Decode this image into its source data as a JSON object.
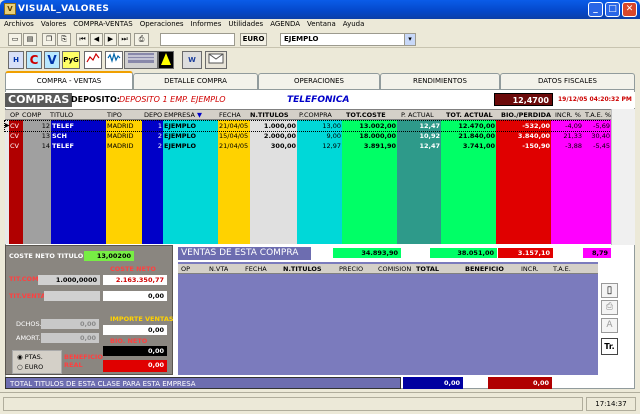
{
  "window": {
    "title": "VISUAL_VALORES",
    "app_icon": "V",
    "min": "_",
    "max": "□",
    "close": "✕"
  },
  "menu": [
    "Archivos",
    "Valores",
    "COMPRA-VENTAS",
    "Operaciones",
    "Informes",
    "Utilidades",
    "AGENDA",
    "Ventana",
    "Ayuda"
  ],
  "toolbar": {
    "currency": "EURO",
    "portfolio": "EJEMPLO"
  },
  "toolbar2": {
    "btn1": "H",
    "btn2": "C",
    "btn3": "V",
    "btn4": "PyG",
    "btn5": "W"
  },
  "tabs": [
    "COMPRA - VENTAS",
    "DETALLE COMPRA",
    "OPERACIONES",
    "RENDIMIENTOS",
    "DATOS FISCALES"
  ],
  "info": {
    "section": "COMPRAS",
    "deposit_label": "DEPOSITO:",
    "deposit_value": "DEPOSITO 1 EMP. EJEMPLO",
    "company": "TELEFONICA",
    "price": "12,4700",
    "datetime": "19/12/05 04:20:32 PM"
  },
  "grid": {
    "headers": [
      "OP",
      "COMPRA",
      "TITULO",
      "TIPO",
      "DEPO",
      "EMPRESA",
      "FECHA",
      "N.TITULOS",
      "P.COMPRA",
      "TOT.COSTE",
      "P. ACTUAL",
      "TOT. ACTUAL",
      "BIO./PERDIDA",
      "INCR. %",
      "T.A.E. %"
    ],
    "rows": [
      {
        "op": "CV",
        "compra": "12",
        "titulo": "TELEF",
        "tipo": "MADRID",
        "depo": "1",
        "empresa": "EJEMPLO",
        "fecha": "21/04/05",
        "ntitulos": "1.000,00",
        "pcompra": "13,00",
        "totcoste": "13.002,00",
        "pactual": "12,47",
        "totactual": "12.470,00",
        "bio": "-532,00",
        "incr": "-4,09",
        "tae": "-5,69"
      },
      {
        "op": "CV",
        "compra": "13",
        "titulo": "SCH",
        "tipo": "MADRID",
        "depo": "2",
        "empresa": "EJEMPLO",
        "fecha": "15/04/05",
        "ntitulos": "2.000,00",
        "pcompra": "9,00",
        "totcoste": "18.000,00",
        "pactual": "10,92",
        "totactual": "21.840,00",
        "bio": "3.840,00",
        "incr": "21,33",
        "tae": "30,40"
      },
      {
        "op": "CV",
        "compra": "14",
        "titulo": "TELEF",
        "tipo": "MADRID",
        "depo": "2",
        "empresa": "EJEMPLO",
        "fecha": "21/04/05",
        "ntitulos": "300,00",
        "pcompra": "12,97",
        "totcoste": "3.891,90",
        "pactual": "12,47",
        "totactual": "3.741,00",
        "bio": "-150,90",
        "incr": "-3,88",
        "tae": "-5,45"
      }
    ],
    "totals": {
      "totcoste": "34.893,90",
      "totactual": "38.051,00",
      "bio": "3.157,10",
      "tae": "8,79"
    }
  },
  "left": {
    "coste_neto_titulo_label": "COSTE NETO TITULO",
    "coste_neto_titulo": "13,00200",
    "tit_comp_label": "TIT.COMP.",
    "tit_comp": "1.000,0000",
    "coste_neto_label": "COSTE NETO",
    "coste_neto": "2.163.350,77",
    "tit_venta_label": "TIT.VENTA",
    "tit_venta": "0,00",
    "dchos_label": "DCHOS.",
    "dchos": "0,00",
    "importe_ventas_label": "IMPORTE VENTAS",
    "importe_ventas": "0,00",
    "amort_label": "AMORT.",
    "amort": "0,00",
    "bio_neto_label": "BIO. NETO",
    "bio_neto": "0,00",
    "ptas": "PTAS.",
    "euro": "EURO",
    "beneficio_real_label": "BENEFICIO REAL",
    "beneficio_real": "0,00"
  },
  "ventas": {
    "title": "VENTAS DE ESTA COMPRA",
    "headers": [
      "OP",
      "N.VTA",
      "FECHA",
      "N.TITULOS",
      "PRECIO",
      "COMISION",
      "TOTAL",
      "BENEFICIO",
      "INCR.",
      "T.A.E."
    ],
    "total1": "0,00",
    "total2": "0,00"
  },
  "status": {
    "text": "TOTAL TITULOS DE ESTA CLASE PARA ESTA EMPRESA",
    "clock": "17:14:37"
  },
  "side_buttons": {
    "a": "A",
    "tr": "Tr."
  },
  "colors": {
    "blue": "#0000c8",
    "yellow": "#ffd200",
    "cyan": "#00d8d8",
    "green": "#00ff66",
    "teal": "#2e9a8a",
    "red": "#e00000",
    "magenta": "#ff00ff"
  }
}
